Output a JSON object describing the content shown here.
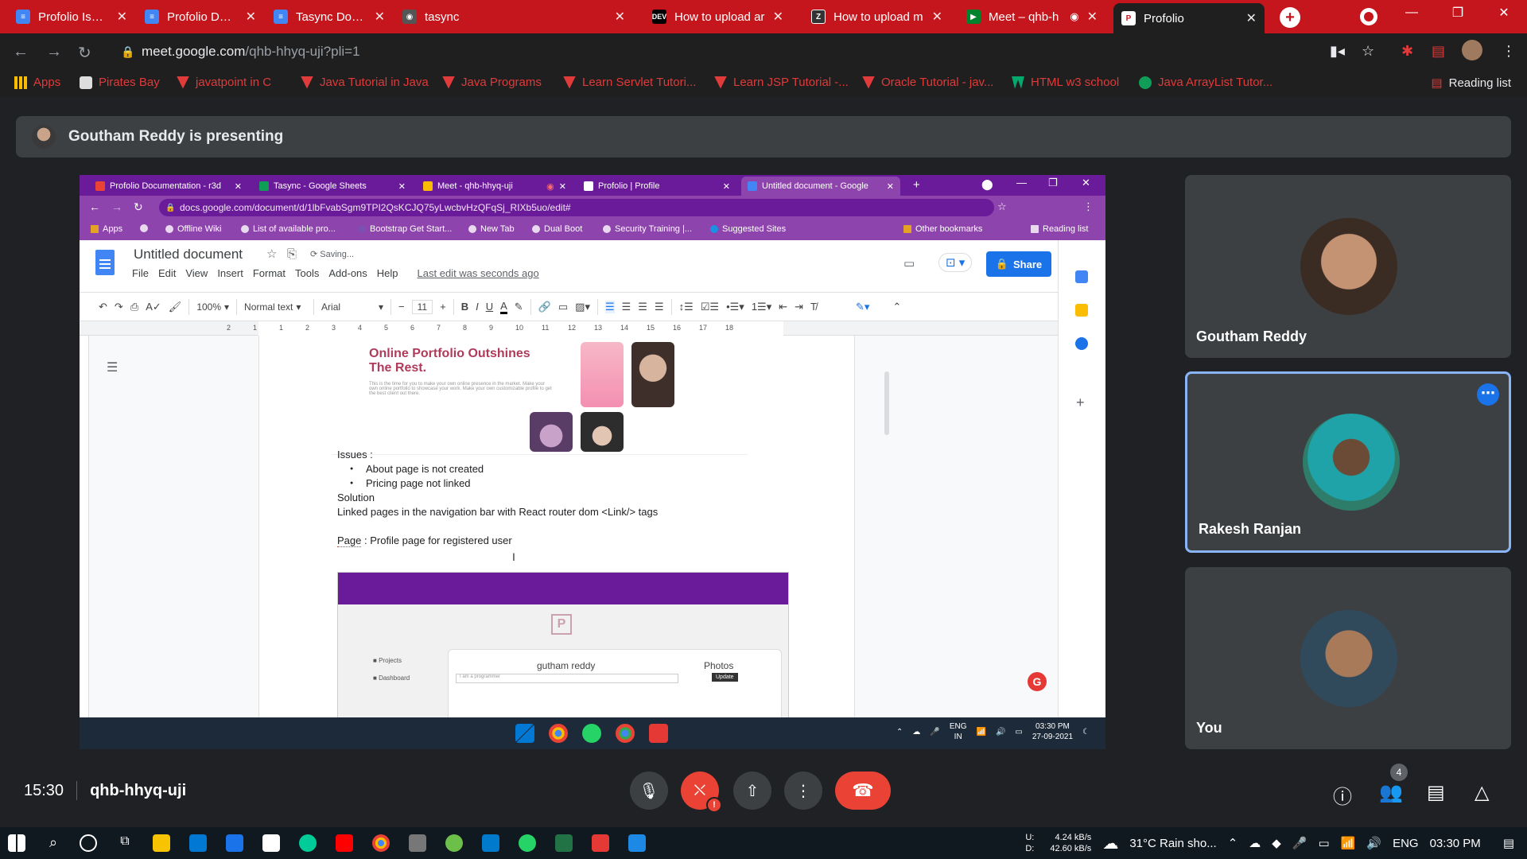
{
  "outer_browser": {
    "tabs": [
      {
        "title": "Profolio Issues doc",
        "icon": "doc-icon",
        "active": false
      },
      {
        "title": "Profolio Documen",
        "icon": "doc-icon",
        "active": false
      },
      {
        "title": "Tasync Document",
        "icon": "doc-icon",
        "active": false
      },
      {
        "title": "tasync",
        "icon": "tasync-icon",
        "active": false
      },
      {
        "title": "How to upload ar",
        "icon": "dev-icon",
        "active": false
      },
      {
        "title": "How to upload m",
        "icon": "z-icon",
        "active": false
      },
      {
        "title": "Meet – qhb-h",
        "icon": "meet-icon",
        "active": false
      },
      {
        "title": "Profolio",
        "icon": "p-icon",
        "active": true
      }
    ],
    "url_host": "meet.google.com",
    "url_path": "/qhb-hhyq-uji?pli=1",
    "bookmarks": [
      {
        "label": "Apps",
        "icon": "apps-grid-icon"
      },
      {
        "label": "Pirates Bay",
        "icon": "pirate-icon"
      },
      {
        "label": "javatpoint in C",
        "icon": "java-icon"
      },
      {
        "label": "Java Tutorial in Java",
        "icon": "java-icon"
      },
      {
        "label": "Java Programs",
        "icon": "java-icon"
      },
      {
        "label": "Learn Servlet Tutori...",
        "icon": "java-icon"
      },
      {
        "label": "Learn JSP Tutorial -...",
        "icon": "java-icon"
      },
      {
        "label": "Oracle Tutorial - jav...",
        "icon": "java-icon"
      },
      {
        "label": "HTML w3 school",
        "icon": "w3-icon"
      },
      {
        "label": "Java ArrayList Tutor...",
        "icon": "arraylist-icon"
      }
    ],
    "reading_list": "Reading list",
    "theme_color": "#c4161c"
  },
  "meet": {
    "presenting_banner": "Goutham Reddy is presenting",
    "time": "15:30",
    "meeting_code": "qhb-hhyq-uji",
    "participant_count": "4",
    "participants": [
      {
        "name": "Goutham Reddy",
        "active": false
      },
      {
        "name": "Rakesh Ranjan",
        "active": true
      },
      {
        "name": "You",
        "active": false
      }
    ]
  },
  "shared_screen": {
    "tabs": [
      {
        "title": "Profolio Documentation - r3d",
        "active": false
      },
      {
        "title": "Tasync - Google Sheets",
        "active": false
      },
      {
        "title": "Meet - qhb-hhyq-uji",
        "active": false
      },
      {
        "title": "Profolio | Profile",
        "active": false
      },
      {
        "title": "Untitled document - Google",
        "active": true
      }
    ],
    "url": "docs.google.com/document/d/1lbFvabSgm9TPI2QsKCJQ75yLwcbvHzQFqSj_RIXb5uo/edit#",
    "bookmarks": [
      "Apps",
      "Offline Wiki",
      "List of available pro...",
      "Bootstrap Get Start...",
      "New Tab",
      "Dual Boot",
      "Security Training |...",
      "Suggested Sites"
    ],
    "other_bookmarks": "Other bookmarks",
    "reading_list": "Reading list",
    "doc": {
      "title": "Untitled document",
      "saving": "Saving...",
      "menus": [
        "File",
        "Edit",
        "View",
        "Insert",
        "Format",
        "Tools",
        "Add-ons",
        "Help"
      ],
      "last_edit": "Last edit was seconds ago",
      "share": "Share",
      "zoom": "100%",
      "style": "Normal text",
      "font": "Arial",
      "font_size": "11",
      "ruler_marks": [
        "2",
        "1",
        "1",
        "2",
        "3",
        "4",
        "5",
        "6",
        "7",
        "8",
        "9",
        "10",
        "11",
        "12",
        "13",
        "14",
        "15",
        "16",
        "17",
        "18"
      ],
      "image_heading": "Online Portfolio Outshines The Rest.",
      "image_subtext": "This is the time for you to make your own online presence in the market. Make your own online portfolio to showcase your work. Make your own customizable profile to get the best client out there.",
      "issues_label": "Issues :",
      "issues": [
        "About page is not created",
        "Pricing page not linked"
      ],
      "solution_label": "Solution",
      "solution_text": "Linked pages in the navigation bar with React router dom <Link/> tags",
      "page_label": "Page",
      "page_text": " : Profile page for registered user",
      "mini_screenshot": {
        "name": "gutham reddy",
        "photos": "Photos",
        "update": "Update",
        "input_placeholder": "I am a programmer",
        "side_items": [
          "Projects",
          "Dashboard"
        ]
      }
    },
    "taskbar": {
      "lang_top": "ENG",
      "lang_bottom": "IN",
      "time": "03:30 PM",
      "date": "27-09-2021"
    }
  },
  "windows_taskbar": {
    "upload_label": "U:",
    "download_label": "D:",
    "upload_speed": "4.24 kB/s",
    "download_speed": "42.60 kB/s",
    "weather": "31°C  Rain sho...",
    "language": "ENG",
    "time": "03:30 PM"
  }
}
